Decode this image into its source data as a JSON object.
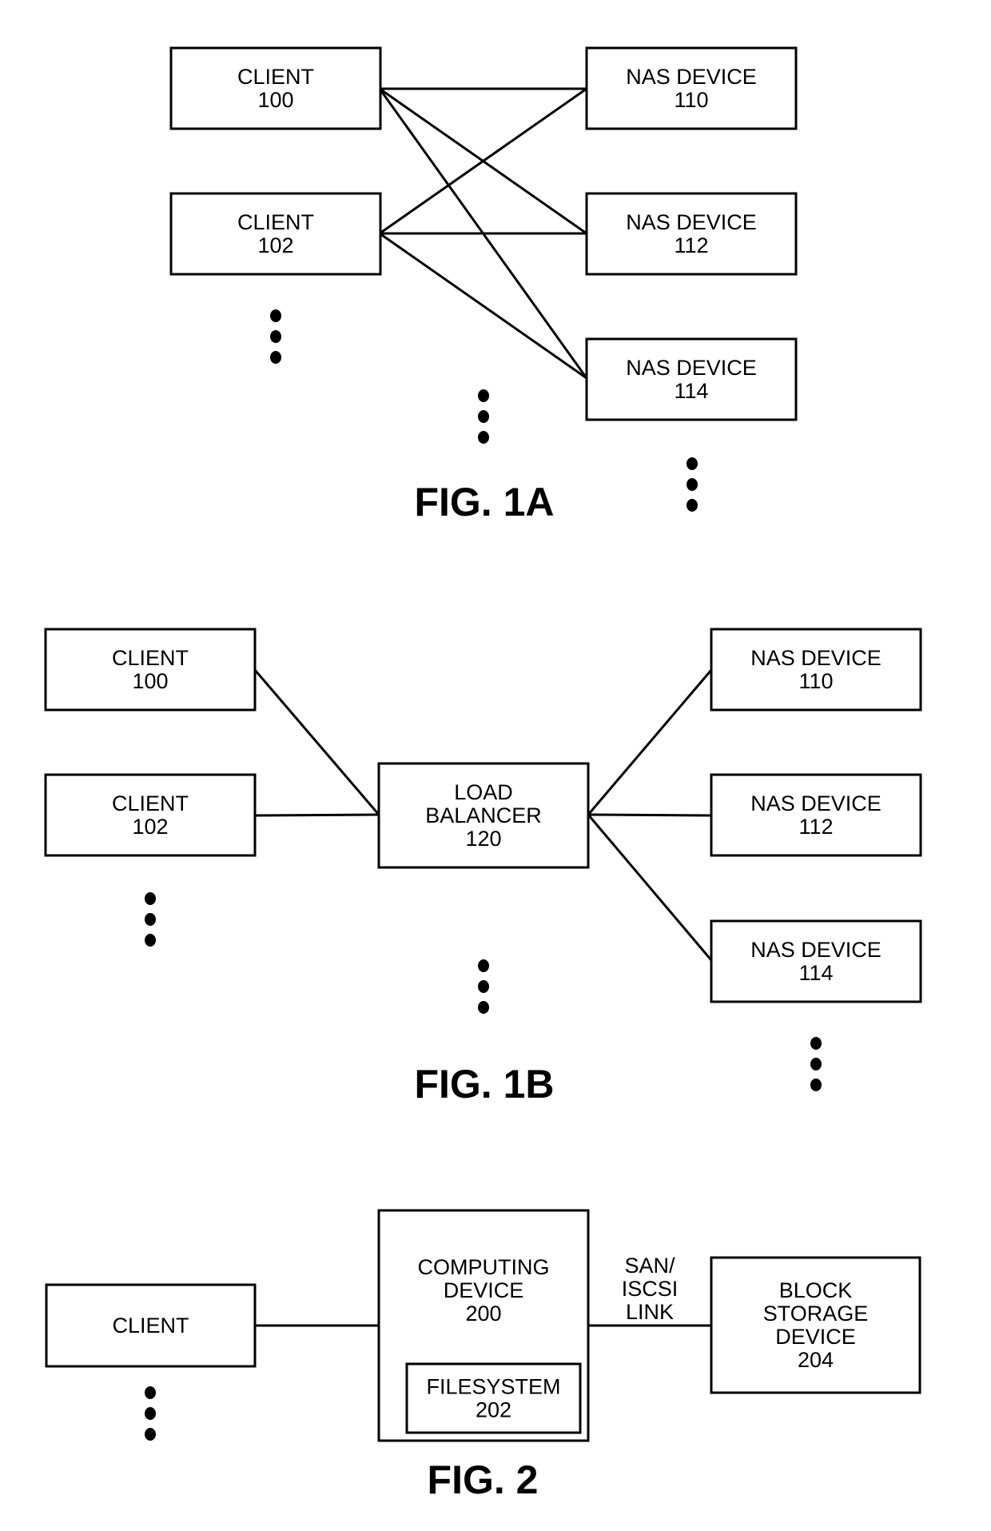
{
  "figures": [
    {
      "id": "fig1a",
      "caption": "FIG. 1A",
      "nodes": [
        {
          "id": "c100",
          "lines": [
            "CLIENT",
            "100"
          ]
        },
        {
          "id": "c102",
          "lines": [
            "CLIENT",
            "102"
          ]
        },
        {
          "id": "n110",
          "lines": [
            "NAS DEVICE",
            "110"
          ]
        },
        {
          "id": "n112",
          "lines": [
            "NAS DEVICE",
            "112"
          ]
        },
        {
          "id": "n114",
          "lines": [
            "NAS DEVICE",
            "114"
          ]
        }
      ],
      "edges": [
        [
          "c100",
          "n110"
        ],
        [
          "c100",
          "n112"
        ],
        [
          "c100",
          "n114"
        ],
        [
          "c102",
          "n110"
        ],
        [
          "c102",
          "n112"
        ],
        [
          "c102",
          "n114"
        ]
      ],
      "ellipses": [
        "more-clients",
        "more-connections",
        "more-nas-devices"
      ]
    },
    {
      "id": "fig1b",
      "caption": "FIG. 1B",
      "nodes": [
        {
          "id": "c100",
          "lines": [
            "CLIENT",
            "100"
          ]
        },
        {
          "id": "c102",
          "lines": [
            "CLIENT",
            "102"
          ]
        },
        {
          "id": "lb120",
          "lines": [
            "LOAD",
            "BALANCER",
            "120"
          ]
        },
        {
          "id": "n110",
          "lines": [
            "NAS DEVICE",
            "110"
          ]
        },
        {
          "id": "n112",
          "lines": [
            "NAS DEVICE",
            "112"
          ]
        },
        {
          "id": "n114",
          "lines": [
            "NAS DEVICE",
            "114"
          ]
        }
      ],
      "edges": [
        [
          "c100",
          "lb120"
        ],
        [
          "c102",
          "lb120"
        ],
        [
          "lb120",
          "n110"
        ],
        [
          "lb120",
          "n112"
        ],
        [
          "lb120",
          "n114"
        ]
      ],
      "ellipses": [
        "more-clients",
        "more-load-balancers",
        "more-nas-devices"
      ]
    },
    {
      "id": "fig2",
      "caption": "FIG. 2",
      "nodes": [
        {
          "id": "client",
          "lines": [
            "CLIENT"
          ]
        },
        {
          "id": "cd200",
          "lines": [
            "COMPUTING",
            "DEVICE",
            "200"
          ]
        },
        {
          "id": "fs202",
          "lines": [
            "FILESYSTEM",
            "202"
          ]
        },
        {
          "id": "bs204",
          "lines": [
            "BLOCK",
            "STORAGE",
            "DEVICE",
            "204"
          ]
        }
      ],
      "edges": [
        [
          "client",
          "cd200"
        ],
        [
          "cd200",
          "bs204"
        ]
      ],
      "edge_labels": [
        {
          "edge": [
            "cd200",
            "bs204"
          ],
          "lines": [
            "SAN/",
            "ISCSI",
            "LINK"
          ]
        }
      ],
      "ellipses": [
        "more-clients"
      ]
    }
  ]
}
